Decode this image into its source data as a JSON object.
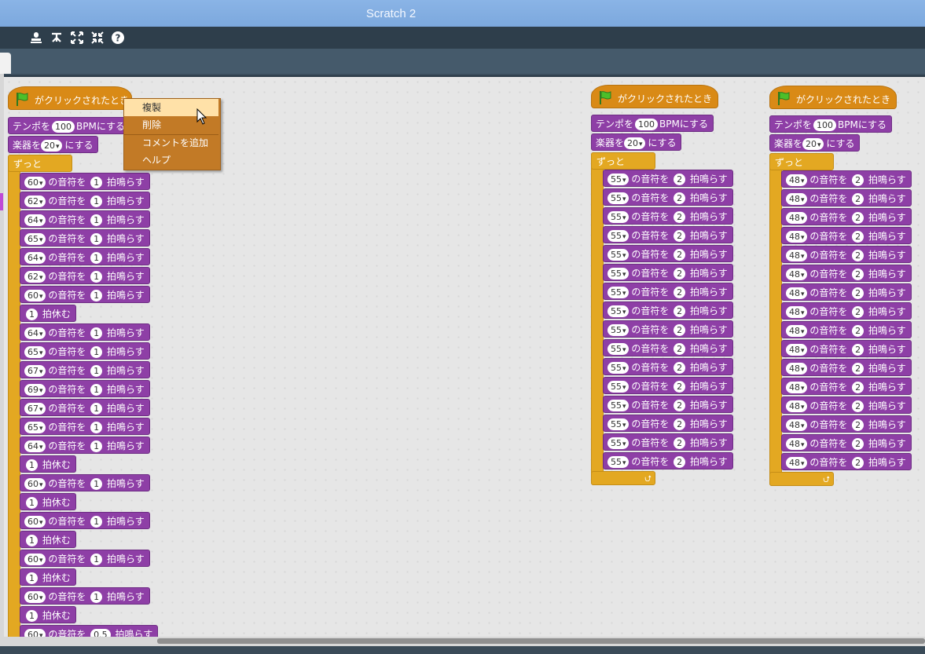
{
  "window": {
    "title": "Scratch 2"
  },
  "toolbar": {
    "icons": [
      "duplicate-stamp-icon",
      "cut-scissors-icon",
      "grow-icon",
      "shrink-icon",
      "help-icon"
    ],
    "help_glyph": "?"
  },
  "blocks": {
    "when_flag_clicked": "がクリックされたとき",
    "set_tempo_prefix": "テンポを",
    "set_tempo_suffix": "BPMにする",
    "set_instrument_prefix": "楽器を",
    "set_instrument_suffix": "にする",
    "forever": "ずっと",
    "note_middle": "の音符を",
    "note_suffix": "拍鳴らす",
    "rest_suffix": "拍休む"
  },
  "scripts": [
    {
      "tempo": "100",
      "instrument": "20",
      "sequence": [
        {
          "t": "note",
          "note": "60",
          "beats": "1"
        },
        {
          "t": "note",
          "note": "62",
          "beats": "1"
        },
        {
          "t": "note",
          "note": "64",
          "beats": "1"
        },
        {
          "t": "note",
          "note": "65",
          "beats": "1"
        },
        {
          "t": "note",
          "note": "64",
          "beats": "1"
        },
        {
          "t": "note",
          "note": "62",
          "beats": "1"
        },
        {
          "t": "note",
          "note": "60",
          "beats": "1"
        },
        {
          "t": "rest",
          "beats": "1"
        },
        {
          "t": "note",
          "note": "64",
          "beats": "1"
        },
        {
          "t": "note",
          "note": "65",
          "beats": "1"
        },
        {
          "t": "note",
          "note": "67",
          "beats": "1"
        },
        {
          "t": "note",
          "note": "69",
          "beats": "1"
        },
        {
          "t": "note",
          "note": "67",
          "beats": "1"
        },
        {
          "t": "note",
          "note": "65",
          "beats": "1"
        },
        {
          "t": "note",
          "note": "64",
          "beats": "1"
        },
        {
          "t": "rest",
          "beats": "1"
        },
        {
          "t": "note",
          "note": "60",
          "beats": "1"
        },
        {
          "t": "rest",
          "beats": "1"
        },
        {
          "t": "note",
          "note": "60",
          "beats": "1"
        },
        {
          "t": "rest",
          "beats": "1"
        },
        {
          "t": "note",
          "note": "60",
          "beats": "1"
        },
        {
          "t": "rest",
          "beats": "1"
        },
        {
          "t": "note",
          "note": "60",
          "beats": "1"
        },
        {
          "t": "rest",
          "beats": "1"
        },
        {
          "t": "note",
          "note": "60",
          "beats": "0.5"
        }
      ]
    },
    {
      "tempo": "100",
      "instrument": "20",
      "sequence": [
        {
          "t": "note",
          "note": "55",
          "beats": "2"
        },
        {
          "t": "note",
          "note": "55",
          "beats": "2"
        },
        {
          "t": "note",
          "note": "55",
          "beats": "2"
        },
        {
          "t": "note",
          "note": "55",
          "beats": "2"
        },
        {
          "t": "note",
          "note": "55",
          "beats": "2"
        },
        {
          "t": "note",
          "note": "55",
          "beats": "2"
        },
        {
          "t": "note",
          "note": "55",
          "beats": "2"
        },
        {
          "t": "note",
          "note": "55",
          "beats": "2"
        },
        {
          "t": "note",
          "note": "55",
          "beats": "2"
        },
        {
          "t": "note",
          "note": "55",
          "beats": "2"
        },
        {
          "t": "note",
          "note": "55",
          "beats": "2"
        },
        {
          "t": "note",
          "note": "55",
          "beats": "2"
        },
        {
          "t": "note",
          "note": "55",
          "beats": "2"
        },
        {
          "t": "note",
          "note": "55",
          "beats": "2"
        },
        {
          "t": "note",
          "note": "55",
          "beats": "2"
        },
        {
          "t": "note",
          "note": "55",
          "beats": "2"
        }
      ]
    },
    {
      "tempo": "100",
      "instrument": "20",
      "sequence": [
        {
          "t": "note",
          "note": "48",
          "beats": "2"
        },
        {
          "t": "note",
          "note": "48",
          "beats": "2"
        },
        {
          "t": "note",
          "note": "48",
          "beats": "2"
        },
        {
          "t": "note",
          "note": "48",
          "beats": "2"
        },
        {
          "t": "note",
          "note": "48",
          "beats": "2"
        },
        {
          "t": "note",
          "note": "48",
          "beats": "2"
        },
        {
          "t": "note",
          "note": "48",
          "beats": "2"
        },
        {
          "t": "note",
          "note": "48",
          "beats": "2"
        },
        {
          "t": "note",
          "note": "48",
          "beats": "2"
        },
        {
          "t": "note",
          "note": "48",
          "beats": "2"
        },
        {
          "t": "note",
          "note": "48",
          "beats": "2"
        },
        {
          "t": "note",
          "note": "48",
          "beats": "2"
        },
        {
          "t": "note",
          "note": "48",
          "beats": "2"
        },
        {
          "t": "note",
          "note": "48",
          "beats": "2"
        },
        {
          "t": "note",
          "note": "48",
          "beats": "2"
        },
        {
          "t": "note",
          "note": "48",
          "beats": "2"
        }
      ]
    }
  ],
  "context_menu": {
    "items": [
      "複製",
      "削除",
      "コメントを追加",
      "ヘルプ"
    ],
    "highlighted_index": 0
  },
  "colors": {
    "motion_hat": "#d98a16",
    "control": "#e3a822",
    "sound": "#8e3fa6",
    "menu": "#c27a26",
    "menu_highlight": "#ffe1a8"
  }
}
